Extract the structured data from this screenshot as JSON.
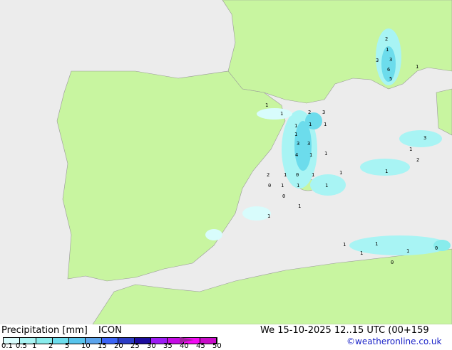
{
  "title": "Precipitation [mm]",
  "model": "ICON",
  "valid_time": "We 15-10-2025 12..15 UTC (00+159",
  "credit": "©weatheronline.co.uk",
  "colors": {
    "sea": "#ececec",
    "land": "#c8f5a0",
    "border": "#999999"
  },
  "legend": {
    "ticks": [
      "0.1",
      "0.5",
      "1",
      "2",
      "5",
      "10",
      "15",
      "20",
      "25",
      "30",
      "35",
      "40",
      "45",
      "50"
    ],
    "swatches": [
      "#d8fcfc",
      "#a8f4f4",
      "#88ecec",
      "#6cdcec",
      "#58c4ec",
      "#5ca4ec",
      "#3c64f4",
      "#2c3cc4",
      "#1c0c9c",
      "#9c1cf4",
      "#c40ce4",
      "#f40cf4",
      "#c80cc8"
    ]
  },
  "labels": [
    "1",
    "1",
    "2",
    "3",
    "2",
    "1",
    "3",
    "3",
    "6",
    "1",
    "5",
    "1",
    "1",
    "1",
    "1",
    "3",
    "3",
    "4",
    "1",
    "1",
    "2",
    "1",
    "0",
    "1",
    "1",
    "0",
    "1",
    "1",
    "1",
    "0",
    "1",
    "1",
    "3",
    "1",
    "2",
    "1",
    "1",
    "1",
    "1",
    "1",
    "0",
    "0"
  ]
}
